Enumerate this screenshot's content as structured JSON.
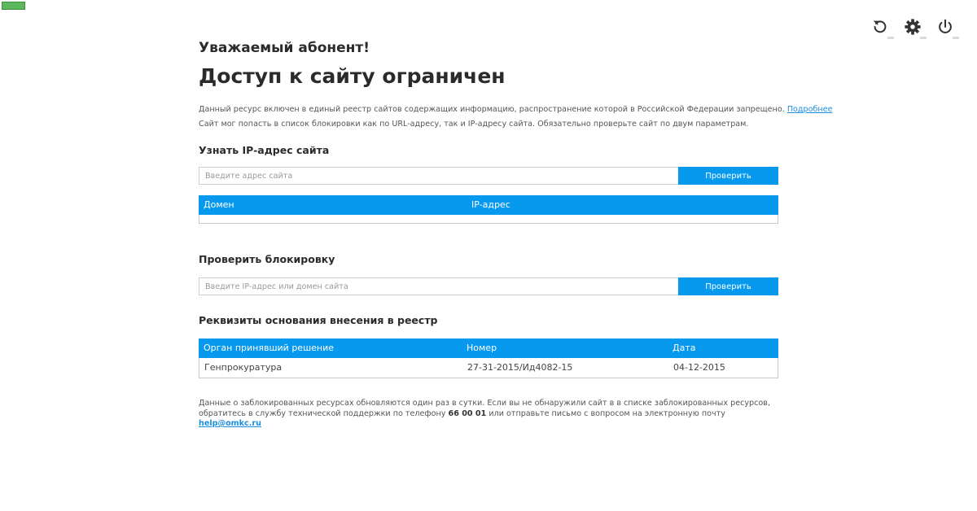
{
  "colors": {
    "accent": "#0699ee",
    "link": "#1a8fe0",
    "text": "#2b2b2b",
    "muted": "#555555"
  },
  "toolbar": {
    "icons": [
      "refresh-icon",
      "gear-icon",
      "power-icon"
    ]
  },
  "page": {
    "greeting": "Уважаемый абонент!",
    "headline": "Доступ к сайту ограничен",
    "info_line1": "Данный ресурс включен в единый реестр сайтов содержащих информацию, распространение которой в Российской Федерации запрещено.",
    "info_link": "Подробнее",
    "info_line2": "Сайт мог попасть в список блокировки как по URL-адресу, так и IP-адресу сайта. Обязательно проверьте сайт по двум параметрам."
  },
  "ip_lookup": {
    "title": "Узнать IP-адрес сайта",
    "placeholder": "Введите адрес сайта",
    "button": "Проверить",
    "columns": [
      "Домен",
      "IP-адрес"
    ]
  },
  "block_check": {
    "title": "Проверить блокировку",
    "placeholder": "Введите IP-адрес или домен сайта",
    "button": "Проверить"
  },
  "registry": {
    "title": "Реквизиты основания внесения в реестр",
    "columns": [
      "Орган принявший решение",
      "Номер",
      "Дата"
    ],
    "rows": [
      [
        "Генпрокуратура",
        "27-31-2015/Ид4082-15",
        "04-12-2015"
      ]
    ]
  },
  "footer": {
    "text_before_phone": "Данные о заблокированных ресурсах обновляются один раз в сутки. Если вы не обнаружили сайт в в списке заблокированных ресурсов, обратитесь в службу технической поддержки по телефону",
    "phone": "66 00 01",
    "text_before_email": "или отправьте письмо с вопросом на электронную почту",
    "email": "help@omkc.ru"
  }
}
